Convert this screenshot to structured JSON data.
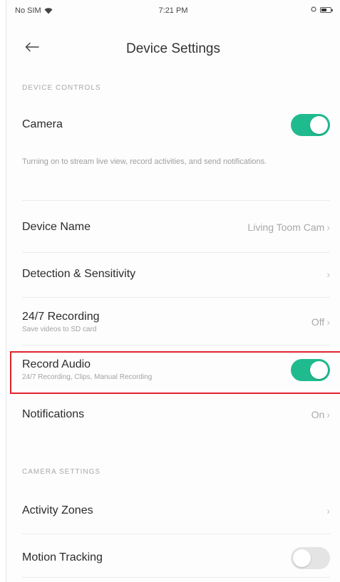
{
  "status_bar": {
    "carrier": "No SIM",
    "time": "7:21 PM"
  },
  "header": {
    "title": "Device Settings"
  },
  "sections": {
    "device_controls": "DEVICE CONTROLS",
    "camera_settings": "CAMERA SETTINGS"
  },
  "camera": {
    "label": "Camera",
    "enabled": true,
    "description": "Turning on to stream live view, record activities, and send notifications."
  },
  "device_name": {
    "label": "Device Name",
    "value": "Living Toom Cam"
  },
  "detection": {
    "label": "Detection & Sensitivity"
  },
  "recording": {
    "label": "24/7 Recording",
    "sub": "Save videos to SD card",
    "value": "Off"
  },
  "record_audio": {
    "label": "Record Audio",
    "sub": "24/7 Recording, Clips, Manual Recording",
    "enabled": true
  },
  "notifications": {
    "label": "Notifications",
    "value": "On"
  },
  "activity_zones": {
    "label": "Activity Zones"
  },
  "motion_tracking": {
    "label": "Motion Tracking",
    "enabled": false
  },
  "colors": {
    "accent": "#1fbb8e",
    "highlight": "#e0242b"
  },
  "icons": {
    "back": "arrow-left-icon",
    "chevron": "chevron-right-icon",
    "wifi": "wifi-icon",
    "battery": "battery-icon"
  }
}
